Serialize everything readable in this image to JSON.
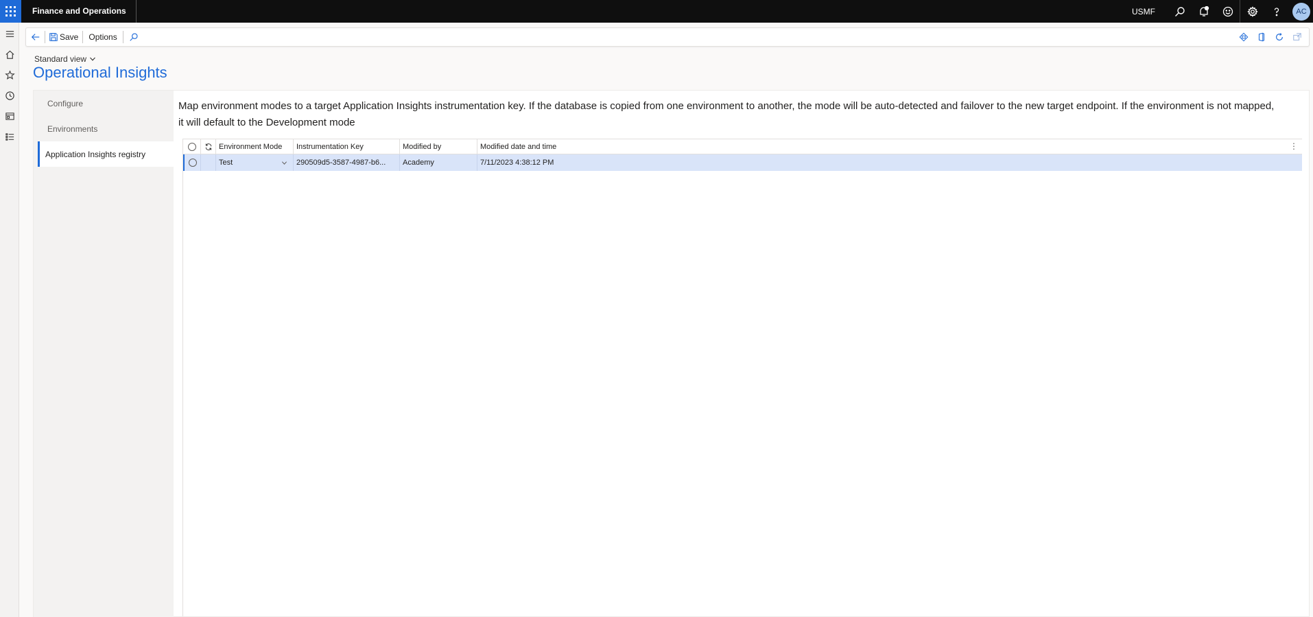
{
  "topbar": {
    "app_name": "Finance and Operations",
    "company": "USMF",
    "avatar_initials": "AC"
  },
  "actionpane": {
    "save_label": "Save",
    "options_label": "Options"
  },
  "page": {
    "view_label": "Standard view",
    "title": "Operational Insights"
  },
  "tabs": [
    {
      "label": "Configure"
    },
    {
      "label": "Environments"
    },
    {
      "label": "Application Insights registry"
    }
  ],
  "description": "Map environment modes to a target Application Insights instrumentation key. If the database is copied from one environment to another, the mode will be auto-detected and failover to the new target endpoint. If the environment is not mapped, it will default to the Development mode",
  "grid": {
    "columns": [
      "Environment Mode",
      "Instrumentation Key",
      "Modified by",
      "Modified date and time"
    ],
    "rows": [
      {
        "mode": "Test",
        "key": "290509d5-3587-4987-b6...",
        "modified_by": "Academy",
        "modified": "7/11/2023 4:38:12 PM"
      }
    ]
  },
  "colors": {
    "accent": "#1f6bd8",
    "topbar": "#0f0f0f",
    "selected_row": "#d9e4f9"
  }
}
